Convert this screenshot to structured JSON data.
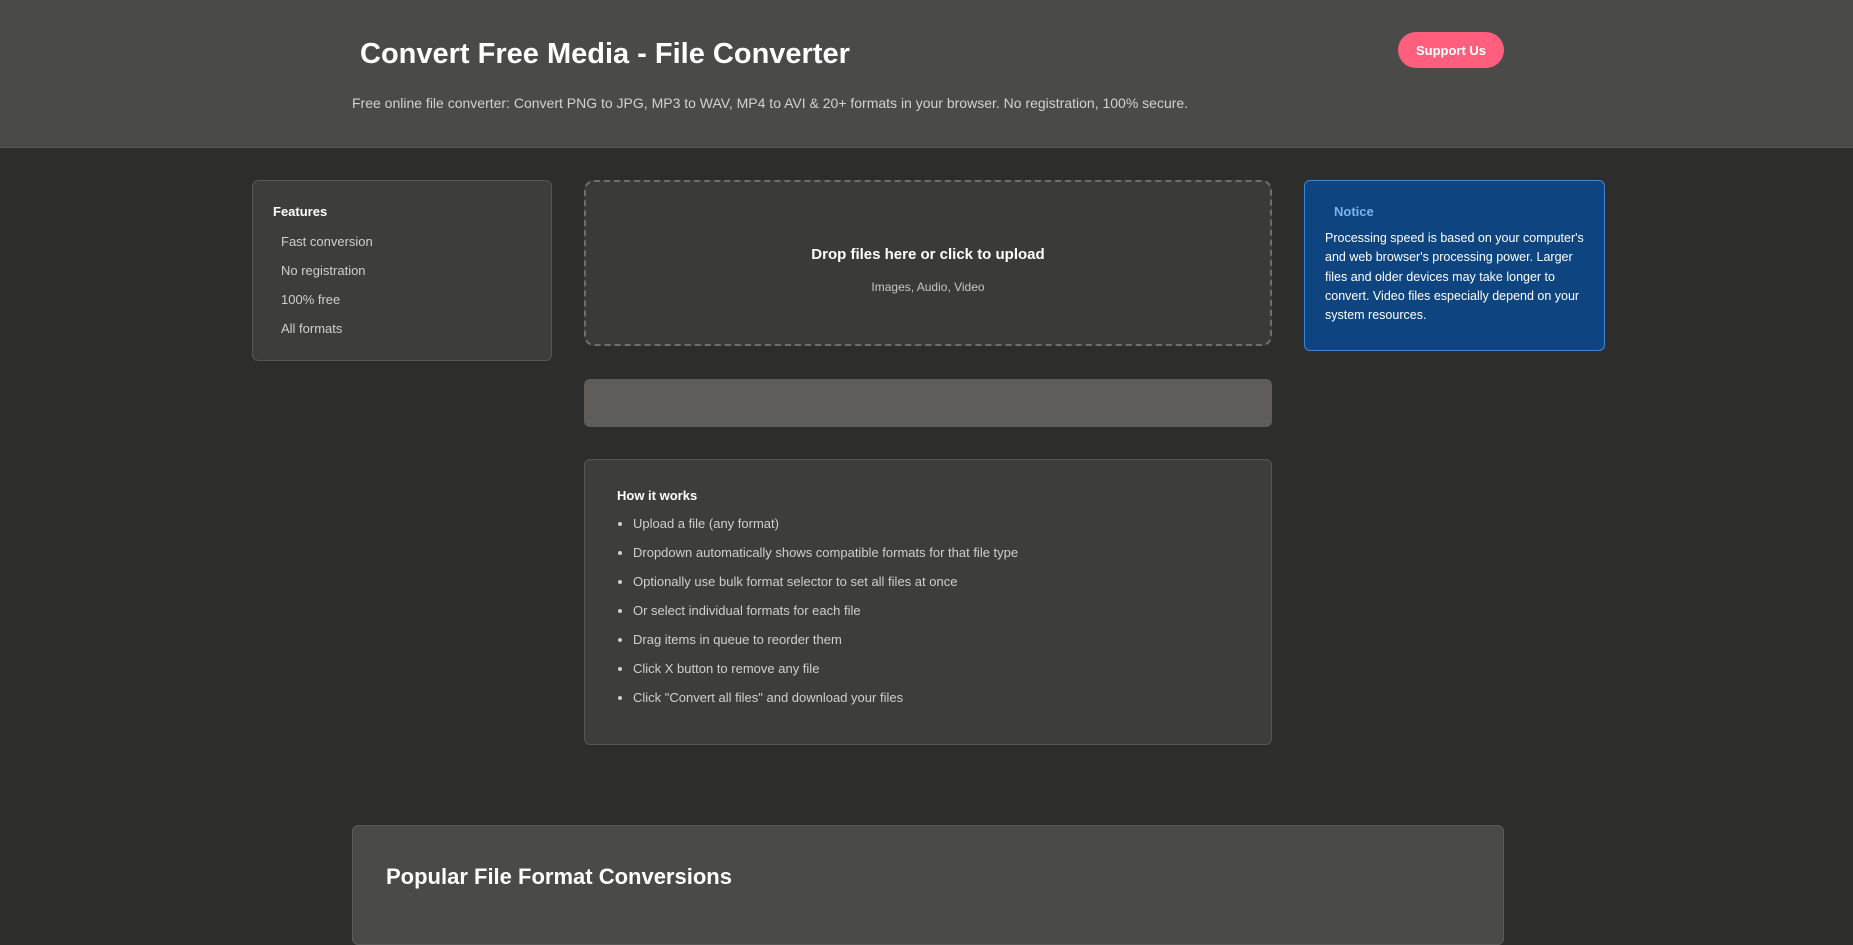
{
  "header": {
    "title": "Convert Free Media - File Converter",
    "subtitle": "Free online file converter: Convert PNG to JPG, MP3 to WAV, MP4 to AVI & 20+ formats in your browser. No registration, 100% secure.",
    "support_label": "Support Us"
  },
  "features": {
    "heading": "Features",
    "items": [
      "Fast conversion",
      "No registration",
      "100% free",
      "All formats"
    ]
  },
  "dropzone": {
    "title": "Drop files here or click to upload",
    "subtitle": "Images, Audio, Video"
  },
  "how_it_works": {
    "heading": "How it works",
    "steps": [
      "Upload a file (any format)",
      "Dropdown automatically shows compatible formats for that file type",
      "Optionally use bulk format selector to set all files at once",
      "Or select individual formats for each file",
      "Drag items in queue to reorder them",
      "Click X button to remove any file",
      "Click \"Convert all files\" and download your files"
    ]
  },
  "notice": {
    "title": "Notice",
    "text": "Processing speed is based on your computer's and web browser's processing power. Larger files and older devices may take longer to convert. Video files especially depend on your system resources."
  },
  "popular": {
    "title": "Popular File Format Conversions"
  },
  "colors": {
    "header_bg": "#4a4a48",
    "page_bg": "#2d2d2b",
    "accent_pink": "#ff5f7d",
    "notice_bg": "#0e4580",
    "notice_title": "#79b3f0"
  }
}
